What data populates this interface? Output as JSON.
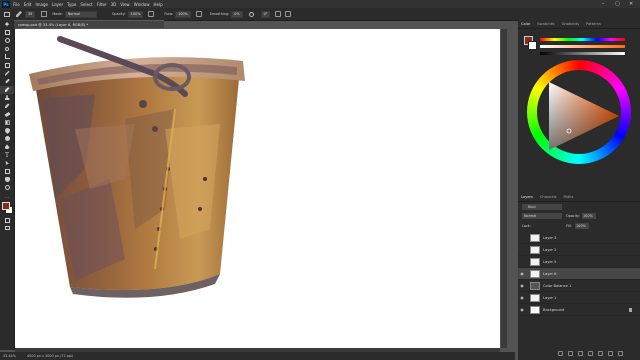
{
  "menubar": {
    "logo": "Ps",
    "items": [
      "File",
      "Edit",
      "Image",
      "Layer",
      "Type",
      "Select",
      "Filter",
      "3D",
      "View",
      "Window",
      "Help"
    ],
    "controls": [
      "–",
      "▢",
      "✕"
    ]
  },
  "options": {
    "size": "35",
    "mode_label": "Mode:",
    "mode": "Normal",
    "opacity_label": "Opacity:",
    "opacity": "100%",
    "flow_label": "Flow:",
    "flow": "100%",
    "smoothing_label": "Smoothing:",
    "smoothing": "0%",
    "angle": "0°"
  },
  "document": {
    "tab_title": "rpmsp.psd @ 33.4% (Layer 6, RGB/8) *"
  },
  "status": {
    "zoom": "33.44%",
    "doc_info": "4000 px x 3000 px (72 ppi)"
  },
  "color_panel": {
    "tabs": [
      "Color",
      "Swatches",
      "Gradients",
      "Patterns"
    ],
    "foreground": "#8a2a1a",
    "background": "#ffffff",
    "hue_color": "#ff6a00"
  },
  "layers_panel": {
    "tabs": [
      "Layers",
      "Channels",
      "Paths"
    ],
    "filter_label": "Kind",
    "blend_mode": "Normal",
    "opacity_label": "Opacity:",
    "opacity": "100%",
    "lock_label": "Lock:",
    "fill_label": "Fill:",
    "fill": "100%",
    "layers": [
      {
        "name": "Layer 3",
        "visible": false,
        "selected": false
      },
      {
        "name": "Layer 2",
        "visible": false,
        "selected": false
      },
      {
        "name": "Layer 5",
        "visible": false,
        "selected": false
      },
      {
        "name": "Layer 6",
        "visible": true,
        "selected": true
      },
      {
        "name": "Color Balance 1",
        "visible": true,
        "selected": false
      },
      {
        "name": "Layer 1",
        "visible": true,
        "selected": false
      },
      {
        "name": "Background",
        "visible": true,
        "selected": false
      }
    ]
  }
}
